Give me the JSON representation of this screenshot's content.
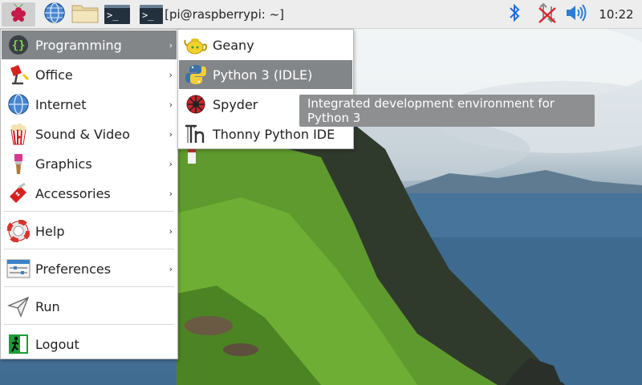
{
  "panel": {
    "taskbar_window_label": "[pi@raspberrypi: ~]",
    "terminal_prompt_glyph": ">_",
    "clock": "10:22",
    "icons": {
      "menu": "raspberry-pi-logo-icon",
      "browser": "globe-icon",
      "files": "folder-icon",
      "terminal": "terminal-icon",
      "bluetooth": "bluetooth-icon",
      "network": "network-disconnected-icon",
      "volume": "speaker-volume-icon"
    },
    "colors": {
      "bluetooth": "#1e6fd9",
      "network_x": "#d9232b",
      "volume": "#2a7ed6"
    }
  },
  "main_menu": {
    "items": [
      {
        "label": "Programming",
        "icon": "programming-braces-icon",
        "has_submenu": true,
        "active": true
      },
      {
        "label": "Office",
        "icon": "office-lamp-icon",
        "has_submenu": true
      },
      {
        "label": "Internet",
        "icon": "internet-globe-icon",
        "has_submenu": true
      },
      {
        "label": "Sound & Video",
        "icon": "sound-video-popcorn-icon",
        "has_submenu": true
      },
      {
        "label": "Graphics",
        "icon": "graphics-brush-icon",
        "has_submenu": true
      },
      {
        "label": "Accessories",
        "icon": "accessories-knife-icon",
        "has_submenu": true
      },
      {
        "label": "Help",
        "icon": "help-lifebuoy-icon",
        "has_submenu": true
      },
      {
        "label": "Preferences",
        "icon": "preferences-sliders-icon",
        "has_submenu": true
      },
      {
        "label": "Run",
        "icon": "run-paper-plane-icon",
        "has_submenu": false
      },
      {
        "label": "Logout",
        "icon": "logout-exit-icon",
        "has_submenu": false
      }
    ],
    "arrow_glyph": "›"
  },
  "programming_submenu": {
    "items": [
      {
        "label": "Geany",
        "icon": "geany-teapot-icon"
      },
      {
        "label": "Python 3 (IDLE)",
        "icon": "python-icon",
        "active": true
      },
      {
        "label": "Spyder",
        "icon": "spyder-icon"
      },
      {
        "label": "Thonny Python IDE",
        "icon": "thonny-icon"
      }
    ]
  },
  "tooltip": {
    "text": "Integrated development environment for Python 3"
  },
  "colors": {
    "active_row": "#838689",
    "panel_bg": "#ededed",
    "tooltip_bg": "#8d8f91"
  }
}
